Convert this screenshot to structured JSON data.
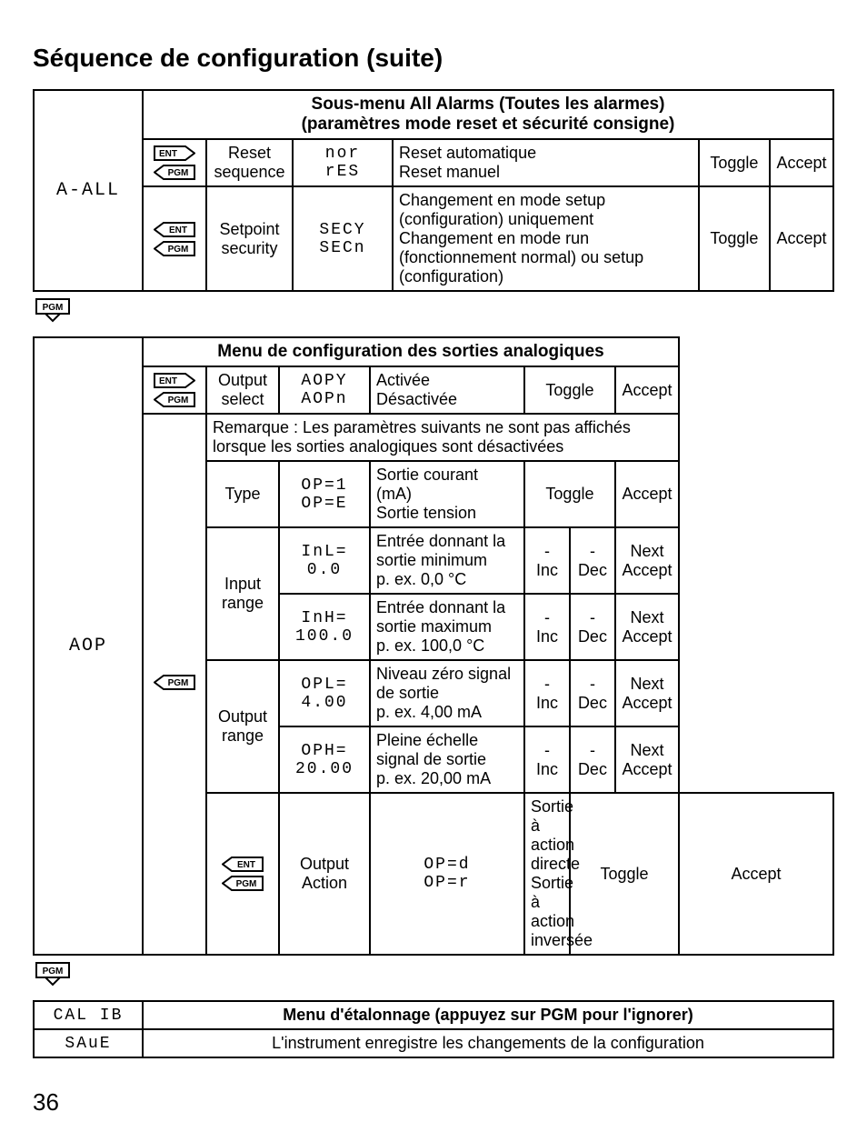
{
  "page_title": "Séquence de configuration (suite)",
  "page_number": "36",
  "keys": {
    "ent": "ENT",
    "pgm": "PGM"
  },
  "table1": {
    "sidebar": "A-ALL",
    "header": {
      "line1": "Sous-menu All Alarms (Toutes les alarmes)",
      "line2": "(paramètres mode reset et sécurité consigne)"
    },
    "rows": [
      {
        "keys": "ent_right_pgm_left",
        "label": "Reset sequence",
        "seg": "nor\nrES",
        "desc": "Reset automatique\nReset manuel",
        "col5": "Toggle",
        "col6": "Accept"
      },
      {
        "keys": "ent_left_pgm_left",
        "label": "Setpoint security",
        "seg": "SECY\nSECn",
        "desc": "Changement en mode setup (configuration) uniquement\nChangement en mode run (fonctionnement normal) ou setup (configuration)",
        "col5": "Toggle",
        "col6": "Accept"
      }
    ]
  },
  "table2": {
    "sidebar": "AOP",
    "header": "Menu de configuration des sorties analogiques",
    "note": "Remarque : Les paramètres suivants ne sont pas affichés lorsque les sorties analogiques sont désactivées",
    "rows": {
      "output_select": {
        "label": "Output select",
        "seg": "AOPY\nAOPn",
        "desc": "Activée\nDésactivée",
        "col5": "Toggle",
        "col6": "Accept"
      },
      "type": {
        "label": "Type",
        "seg": "OP=1\nOP=E",
        "desc": "Sortie courant (mA)\nSortie tension",
        "col5": "Toggle",
        "col6": "Accept"
      },
      "input_low": {
        "seg": "InL=\n0.0",
        "desc": "Entrée donnant la sortie minimum\np. ex. 0,0 °C",
        "c5a": "-\nInc",
        "c5b": "-\nDec",
        "c6": "Next\nAccept"
      },
      "input_high": {
        "seg": "InH=\n100.0",
        "desc": "Entrée donnant la sortie maximum\np. ex. 100,0 °C",
        "c5a": "-\nInc",
        "c5b": "-\nDec",
        "c6": "Next\nAccept"
      },
      "input_label": "Input range",
      "output_low": {
        "seg": "OPL=\n4.00",
        "desc": "Niveau zéro signal de sortie\np. ex. 4,00 mA",
        "c5a": "-\nInc",
        "c5b": "-\nDec",
        "c6": "Next\nAccept"
      },
      "output_high": {
        "seg": "OPH=\n20.00",
        "desc": "Pleine échelle signal de sortie\np. ex. 20,00 mA",
        "c5a": "-\nInc",
        "c5b": "-\nDec",
        "c6": "Next\nAccept"
      },
      "output_label": "Output range",
      "output_action": {
        "label": "Output Action",
        "seg": "OP=d\nOP=r",
        "desc": "Sortie à action directe\nSortie à action inversée",
        "col5": "Toggle",
        "col6": "Accept"
      }
    }
  },
  "table3": {
    "row1": {
      "left": "CAL IB",
      "right": "Menu d'étalonnage (appuyez sur PGM pour l'ignorer)"
    },
    "row2": {
      "left": "SAuE",
      "right": "L'instrument enregistre les changements de la configuration"
    }
  }
}
